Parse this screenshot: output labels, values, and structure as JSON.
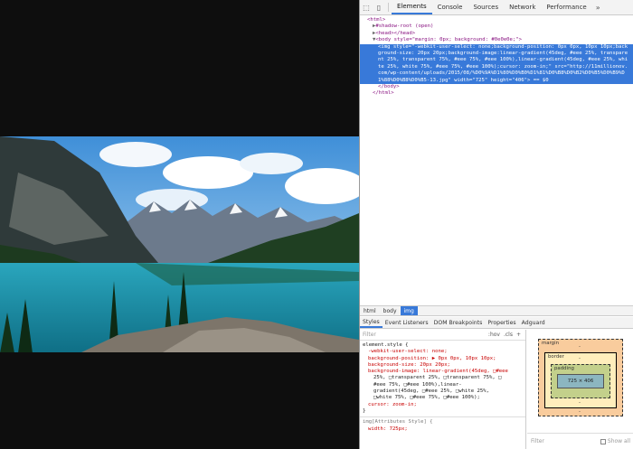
{
  "devtools": {
    "toolbar": {
      "tabs": [
        "Elements",
        "Console",
        "Sources",
        "Network",
        "Performance"
      ],
      "more": "»"
    },
    "dom": {
      "l1": "<html>",
      "l2": "#shadow-root (open)",
      "l3": "<head></head>",
      "l4": "<body style=\"margin: 0px; background: #0e0e0e;\">",
      "selected": "<img style=\"-webkit-user-select: none;background-position: 0px 0px, 10px 10px;background-size: 20px 20px;background-image:linear-gradient(45deg, #eee 25%, transparent 25%, transparent 75%, #eee 75%, #eee 100%),linear-gradient(45deg, #eee 25%, white 25%, white 75%, #eee 75%, #eee 100%);cursor: zoom-in;\" src=\"http://11millionov.com/wp-content/uploads/2015/08/%D0%9A%D1%80%D0%B0%D1%81%D0%B8%D0%B2%D0%B5%D0%B9%D1%88%D0%B8%D0%B5-13.jpg\" width=\"725\" height=\"406\"> == $0",
      "l6": "</body>",
      "l7": "</html>"
    },
    "breadcrumbs": [
      "html",
      "body",
      "img"
    ],
    "subtabs": [
      "Styles",
      "Event Listeners",
      "DOM Breakpoints",
      "Properties",
      "Adguard"
    ],
    "styles": {
      "filter_placeholder": "Filter",
      "hov": ":hov",
      "cls": ".cls",
      "plus": "+",
      "selector": "element.style {",
      "p1": "-webkit-user-select: none;",
      "p2": "background-position: ▶ 0px 0px, 10px 10px;",
      "p3": "background-size: 20px 20px;",
      "p4": "background-image: linear-gradient(45deg, □#eee",
      "p4b": "25%, □transparent 25%, □transparent 75%, □",
      "p4c": "#eee 75%, □#eee 100%),linear-",
      "p4d": "gradient(45deg, □#eee 25%, □white 25%,",
      "p4e": "□white 75%, □#eee 75%, □#eee 100%);",
      "p5": "cursor: zoom-in;",
      "close": "}",
      "attr_selector": "img[Attributes Style] {",
      "attr_prop": "width: 725px;"
    },
    "boxmodel": {
      "margin": "margin",
      "border": "border",
      "padding": "padding",
      "content": "725 × 406",
      "dash": "-",
      "filter": "Filter",
      "show_all": "Show all"
    }
  }
}
